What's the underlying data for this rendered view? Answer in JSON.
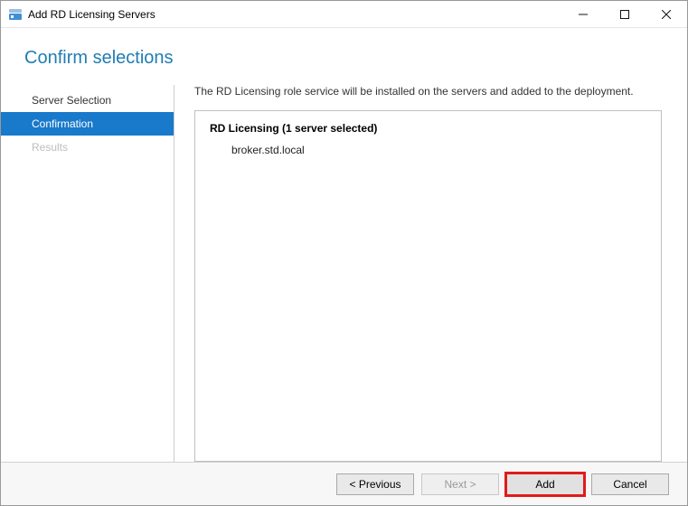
{
  "window": {
    "title": "Add RD Licensing Servers"
  },
  "heading": "Confirm selections",
  "sidebar": {
    "items": [
      {
        "label": "Server Selection",
        "state": "normal"
      },
      {
        "label": "Confirmation",
        "state": "active"
      },
      {
        "label": "Results",
        "state": "disabled"
      }
    ]
  },
  "main": {
    "description": "The RD Licensing role service will be installed on the servers and added to the deployment.",
    "panel_title": "RD Licensing  (1 server selected)",
    "servers": [
      "broker.std.local"
    ]
  },
  "footer": {
    "previous": "< Previous",
    "next": "Next >",
    "add": "Add",
    "cancel": "Cancel"
  }
}
